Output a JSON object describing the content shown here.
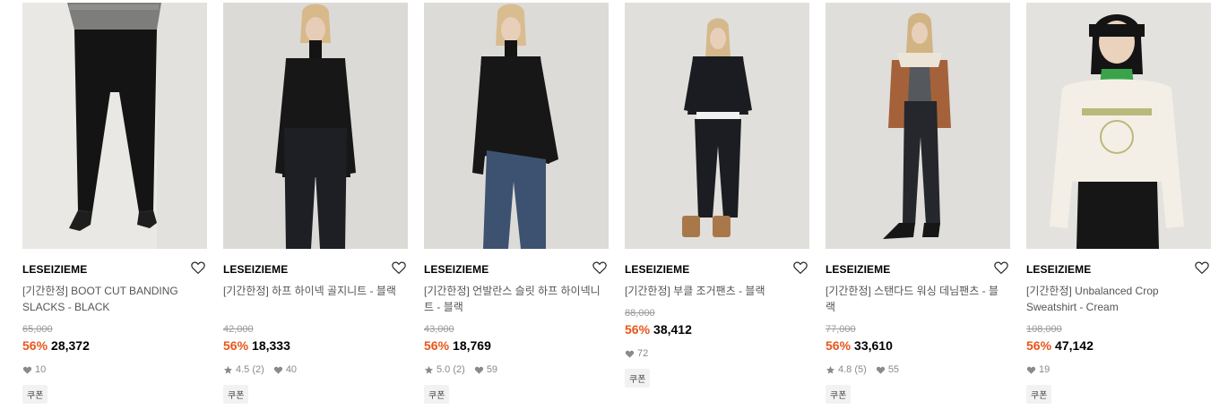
{
  "products": [
    {
      "brand": "LESEIZIEME",
      "name": "[기간한정] BOOT CUT BANDING SLACKS - BLACK",
      "original_price": "65,000",
      "discount": "56%",
      "price": "28,372",
      "rating": "",
      "review_count": "",
      "likes": "10",
      "coupon": "쿠폰",
      "bg": "#e9e8e4"
    },
    {
      "brand": "LESEIZIEME",
      "name": "[기간한정] 하프 하이넥 골지니트 - 블랙",
      "original_price": "42,000",
      "discount": "56%",
      "price": "18,333",
      "rating": "4.5",
      "review_count": "(2)",
      "likes": "40",
      "coupon": "쿠폰",
      "bg": "#dcdad6"
    },
    {
      "brand": "LESEIZIEME",
      "name": "[기간한정] 언발란스 슬릿 하프 하이넥니트 - 블랙",
      "original_price": "43,000",
      "discount": "56%",
      "price": "18,769",
      "rating": "5.0",
      "review_count": "(2)",
      "likes": "59",
      "coupon": "쿠폰",
      "bg": "#dddbd7"
    },
    {
      "brand": "LESEIZIEME",
      "name": "[기간한정] 부클 조거팬츠 - 블랙",
      "original_price": "88,000",
      "discount": "56%",
      "price": "38,412",
      "rating": "",
      "review_count": "",
      "likes": "72",
      "coupon": "쿠폰",
      "bg": "#e0dfdb"
    },
    {
      "brand": "LESEIZIEME",
      "name": "[기간한정] 스탠다드 워싱 데님팬츠 - 블랙",
      "original_price": "77,000",
      "discount": "56%",
      "price": "33,610",
      "rating": "4.8",
      "review_count": "(5)",
      "likes": "55",
      "coupon": "쿠폰",
      "bg": "#dfdedb"
    },
    {
      "brand": "LESEIZIEME",
      "name": "[기간한정] Unbalanced Crop Sweatshirt - Cream",
      "original_price": "108,000",
      "discount": "56%",
      "price": "47,142",
      "rating": "",
      "review_count": "",
      "likes": "19",
      "coupon": "쿠폰",
      "bg": "#e4e2df"
    }
  ],
  "colors": {
    "discount": "#e8561a",
    "muted": "#9a9a9a"
  },
  "icons": {
    "wishlist": "heart-outline-icon",
    "likes": "heart-filled-icon",
    "rating": "star-icon"
  }
}
